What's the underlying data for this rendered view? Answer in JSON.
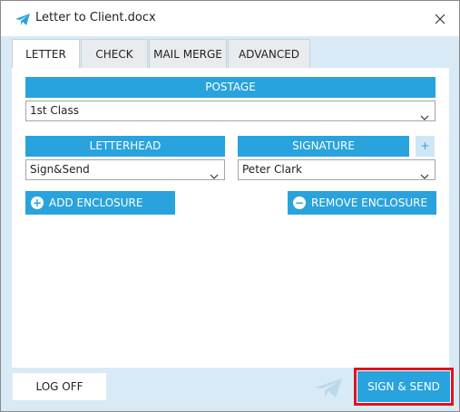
{
  "window": {
    "title": "Letter to Client.docx",
    "app_icon": "paper-plane-icon",
    "close_icon": "close-icon"
  },
  "tabs": [
    {
      "label": "LETTER",
      "active": true
    },
    {
      "label": "CHECK",
      "active": false
    },
    {
      "label": "MAIL MERGE",
      "active": false
    },
    {
      "label": "ADVANCED",
      "active": false
    }
  ],
  "postage": {
    "header": "POSTAGE",
    "value": "1st Class"
  },
  "letterhead": {
    "header": "LETTERHEAD",
    "value": "Sign&Send"
  },
  "signature": {
    "header": "SIGNATURE",
    "value": "Peter Clark",
    "add_label": "+"
  },
  "enclosure": {
    "add_label": "ADD ENCLOSURE",
    "add_icon": "+",
    "remove_label": "REMOVE ENCLOSURE",
    "remove_icon": "−"
  },
  "footer": {
    "logoff_label": "LOG OFF",
    "send_label": "SIGN & SEND"
  },
  "colors": {
    "accent": "#29a3dd",
    "body_bg": "#d9eaf7",
    "highlight": "#e0121a"
  }
}
